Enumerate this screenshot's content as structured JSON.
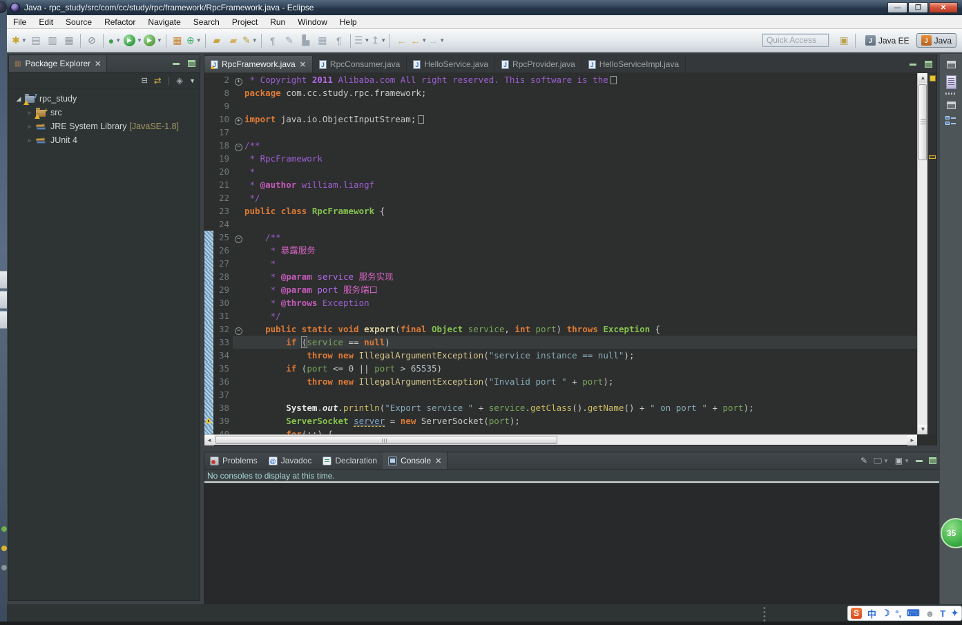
{
  "window": {
    "title": "Java - rpc_study/src/com/cc/study/rpc/framework/RpcFramework.java - Eclipse"
  },
  "titlebar_buttons": {
    "minimize": "—",
    "restore": "❐",
    "close": "✕"
  },
  "menubar": [
    "File",
    "Edit",
    "Source",
    "Refactor",
    "Navigate",
    "Search",
    "Project",
    "Run",
    "Window",
    "Help"
  ],
  "toolbar": {
    "quick_access_placeholder": "Quick Access",
    "perspectives": [
      {
        "label": "Java EE",
        "active": false
      },
      {
        "label": "Java",
        "active": true
      }
    ],
    "buttons": [
      {
        "name": "new-wizard",
        "glyph": "✱",
        "color": "#c9a227",
        "dd": true
      },
      {
        "name": "save",
        "glyph": "▤",
        "color": "#8f98a2"
      },
      {
        "name": "save-all",
        "glyph": "▥",
        "color": "#8f98a2"
      },
      {
        "name": "print",
        "glyph": "▦",
        "color": "#8f98a2"
      },
      {
        "name": "sep1",
        "sep": true
      },
      {
        "name": "skip-all-breakpoints",
        "glyph": "⊘",
        "color": "#7b8894"
      },
      {
        "name": "sep2",
        "sep": true
      },
      {
        "name": "debug",
        "glyph": "●",
        "color": "#3f9d4c",
        "dd": true
      },
      {
        "name": "run",
        "glyph": "▶",
        "circle": "#2f9e44",
        "dd": true
      },
      {
        "name": "run-last-launched",
        "glyph": "▶",
        "circle": "#5a9e44",
        "dot": "#c2302a",
        "dd": true
      },
      {
        "name": "sep3",
        "sep": true
      },
      {
        "name": "coverage",
        "glyph": "▦",
        "color": "#c77f2e",
        "dd": false
      },
      {
        "name": "new-java-class",
        "glyph": "⊕",
        "color": "#3fae6a",
        "dd": true
      },
      {
        "name": "sep4",
        "sep": true
      },
      {
        "name": "open-type",
        "glyph": "▰",
        "color": "#c9a23f"
      },
      {
        "name": "open-resource",
        "glyph": "▰",
        "color": "#d4b25f"
      },
      {
        "name": "search",
        "glyph": "✎",
        "color": "#b8a14a",
        "dd": true
      },
      {
        "name": "sep5",
        "sep": true
      },
      {
        "name": "show-whitespace",
        "glyph": "¶",
        "color": "#9aa6b0"
      },
      {
        "name": "mark-occurrences",
        "glyph": "✎",
        "color": "#9aa6b0"
      },
      {
        "name": "format",
        "glyph": "▙",
        "color": "#9aa6b0"
      },
      {
        "name": "show-source",
        "glyph": "▦",
        "color": "#9aa6b0"
      },
      {
        "name": "paragraph",
        "glyph": "¶",
        "color": "#9aa6b0"
      },
      {
        "name": "sep6",
        "sep": true
      },
      {
        "name": "last-edit-location",
        "glyph": "☰",
        "color": "#9aa6b0",
        "dd": true
      },
      {
        "name": "next-annotation",
        "glyph": "↥",
        "color": "#9aa6b0",
        "dd": true
      },
      {
        "name": "sep7",
        "sep": true
      },
      {
        "name": "back-history",
        "glyph": "←",
        "color": "#cdb36a"
      },
      {
        "name": "back",
        "glyph": "←",
        "color": "#e0a83c",
        "dd": true
      },
      {
        "name": "forward",
        "glyph": "→",
        "color": "#b9c0c6",
        "dd": true
      }
    ]
  },
  "package_explorer": {
    "title": "Package Explorer",
    "tree": [
      {
        "label": "rpc_study",
        "icon": "project",
        "expander": "open",
        "warn": true,
        "indent": 0
      },
      {
        "label": "src",
        "icon": "package",
        "expander": "closed",
        "warn": true,
        "indent": 1
      },
      {
        "label": "JRE System Library",
        "suffix": "[JavaSE-1.8]",
        "icon": "library",
        "expander": "closed",
        "warn": false,
        "indent": 1
      },
      {
        "label": "JUnit 4",
        "icon": "library",
        "expander": "closed",
        "warn": false,
        "indent": 1
      }
    ]
  },
  "editor": {
    "tabs": [
      {
        "label": "RpcFramework.java",
        "active": true,
        "warn": true,
        "closable": true
      },
      {
        "label": "RpcConsumer.java",
        "active": false
      },
      {
        "label": "HelloService.java",
        "active": false
      },
      {
        "label": "RpcProvider.java",
        "active": false
      },
      {
        "label": "HelloServiceImpl.java",
        "active": false
      }
    ],
    "lines": [
      {
        "n": "2",
        "fold": "+",
        "endbox": true,
        "seg": [
          [
            "c",
            " * Copyright "
          ],
          [
            "cb",
            "2011"
          ],
          [
            "c",
            " Alibaba.com All right reserved. This software is the"
          ]
        ]
      },
      {
        "n": "8",
        "seg": [
          [
            "k",
            "package"
          ],
          [
            "d",
            " com.cc.study.rpc.framework;"
          ]
        ]
      },
      {
        "n": "9",
        "seg": []
      },
      {
        "n": "10",
        "fold": "+",
        "endbox": true,
        "seg": [
          [
            "k",
            "import"
          ],
          [
            "d",
            " java.io.ObjectInputStream;"
          ]
        ]
      },
      {
        "n": "17",
        "seg": []
      },
      {
        "n": "18",
        "fold": "-",
        "seg": [
          [
            "c",
            "/**"
          ]
        ]
      },
      {
        "n": "19",
        "seg": [
          [
            "c",
            " * RpcFramework"
          ]
        ]
      },
      {
        "n": "20",
        "seg": [
          [
            "c",
            " * "
          ]
        ]
      },
      {
        "n": "21",
        "seg": [
          [
            "c",
            " * "
          ],
          [
            "ct",
            "@author"
          ],
          [
            "c",
            " william.liangf"
          ]
        ]
      },
      {
        "n": "22",
        "seg": [
          [
            "c",
            " */"
          ]
        ]
      },
      {
        "n": "23",
        "seg": [
          [
            "k",
            "public"
          ],
          [
            "d",
            " "
          ],
          [
            "k",
            "class"
          ],
          [
            "d",
            " "
          ],
          [
            "t",
            "RpcFramework"
          ],
          [
            "d",
            " {"
          ]
        ]
      },
      {
        "n": "24",
        "seg": []
      },
      {
        "n": "25",
        "fold": "-",
        "range": true,
        "seg": [
          [
            "d",
            "    "
          ],
          [
            "c",
            "/**"
          ]
        ]
      },
      {
        "n": "26",
        "range": true,
        "seg": [
          [
            "c",
            "     * "
          ],
          [
            "cn",
            "暴露服务"
          ]
        ]
      },
      {
        "n": "27",
        "range": true,
        "seg": [
          [
            "c",
            "     * "
          ]
        ]
      },
      {
        "n": "28",
        "range": true,
        "seg": [
          [
            "c",
            "     * "
          ],
          [
            "ct",
            "@param"
          ],
          [
            "c",
            " "
          ],
          [
            "ci",
            "service"
          ],
          [
            "c",
            " "
          ],
          [
            "cn",
            "服务实现"
          ]
        ]
      },
      {
        "n": "29",
        "range": true,
        "seg": [
          [
            "c",
            "     * "
          ],
          [
            "ct",
            "@param"
          ],
          [
            "c",
            " "
          ],
          [
            "ci",
            "port"
          ],
          [
            "c",
            " "
          ],
          [
            "cn",
            "服务端口"
          ]
        ]
      },
      {
        "n": "30",
        "range": true,
        "seg": [
          [
            "c",
            "     * "
          ],
          [
            "ct",
            "@throws"
          ],
          [
            "c",
            " Exception"
          ]
        ]
      },
      {
        "n": "31",
        "range": true,
        "seg": [
          [
            "c",
            "     */"
          ]
        ]
      },
      {
        "n": "32",
        "fold": "-",
        "range": true,
        "seg": [
          [
            "d",
            "    "
          ],
          [
            "k",
            "public"
          ],
          [
            "d",
            " "
          ],
          [
            "k",
            "static"
          ],
          [
            "d",
            " "
          ],
          [
            "k",
            "void"
          ],
          [
            "d",
            " "
          ],
          [
            "md",
            "export"
          ],
          [
            "d",
            "("
          ],
          [
            "k",
            "final"
          ],
          [
            "d",
            " "
          ],
          [
            "t",
            "Object"
          ],
          [
            "d",
            " "
          ],
          [
            "v",
            "service"
          ],
          [
            "d",
            ", "
          ],
          [
            "k",
            "int"
          ],
          [
            "d",
            " "
          ],
          [
            "v",
            "port"
          ],
          [
            "d",
            ") "
          ],
          [
            "k",
            "throws"
          ],
          [
            "d",
            " "
          ],
          [
            "t",
            "Exception"
          ],
          [
            "d",
            " {"
          ]
        ]
      },
      {
        "n": "33",
        "range": true,
        "cur": true,
        "seg": [
          [
            "d",
            "        "
          ],
          [
            "k",
            "if"
          ],
          [
            "d",
            " "
          ],
          [
            "bb",
            "("
          ],
          [
            "v",
            "service"
          ],
          [
            "d",
            " == "
          ],
          [
            "k",
            "null"
          ],
          [
            "d",
            ")"
          ]
        ]
      },
      {
        "n": "34",
        "range": true,
        "seg": [
          [
            "d",
            "            "
          ],
          [
            "k",
            "throw"
          ],
          [
            "d",
            " "
          ],
          [
            "k",
            "new"
          ],
          [
            "d",
            " "
          ],
          [
            "ex",
            "IllegalArgumentException"
          ],
          [
            "d",
            "("
          ],
          [
            "s",
            "\"service instance == null\""
          ],
          [
            "d",
            ");"
          ]
        ]
      },
      {
        "n": "35",
        "range": true,
        "seg": [
          [
            "d",
            "        "
          ],
          [
            "k",
            "if"
          ],
          [
            "d",
            " ("
          ],
          [
            "v",
            "port"
          ],
          [
            "d",
            " <= "
          ],
          [
            "n2",
            "0"
          ],
          [
            "d",
            " || "
          ],
          [
            "v",
            "port"
          ],
          [
            "d",
            " > "
          ],
          [
            "n2",
            "65535"
          ],
          [
            "d",
            ")"
          ]
        ]
      },
      {
        "n": "36",
        "range": true,
        "seg": [
          [
            "d",
            "            "
          ],
          [
            "k",
            "throw"
          ],
          [
            "d",
            " "
          ],
          [
            "k",
            "new"
          ],
          [
            "d",
            " "
          ],
          [
            "ex",
            "IllegalArgumentException"
          ],
          [
            "d",
            "("
          ],
          [
            "s",
            "\"Invalid port \""
          ],
          [
            "d",
            " + "
          ],
          [
            "v",
            "port"
          ],
          [
            "d",
            ");"
          ]
        ]
      },
      {
        "n": "37",
        "range": true,
        "seg": []
      },
      {
        "n": "38",
        "range": true,
        "seg": [
          [
            "d",
            "        "
          ],
          [
            "sb",
            "System"
          ],
          [
            "d",
            "."
          ],
          [
            "si",
            "out"
          ],
          [
            "d",
            "."
          ],
          [
            "m",
            "println"
          ],
          [
            "d",
            "("
          ],
          [
            "s",
            "\"Export service \""
          ],
          [
            "d",
            " + "
          ],
          [
            "v",
            "service"
          ],
          [
            "d",
            "."
          ],
          [
            "m",
            "getClass"
          ],
          [
            "d",
            "()."
          ],
          [
            "m",
            "getName"
          ],
          [
            "d",
            "() + "
          ],
          [
            "s",
            "\" on port \""
          ],
          [
            "d",
            " + "
          ],
          [
            "v",
            "port"
          ],
          [
            "d",
            ");"
          ]
        ]
      },
      {
        "n": "39",
        "range": true,
        "warn": true,
        "seg": [
          [
            "d",
            "        "
          ],
          [
            "t",
            "ServerSocket"
          ],
          [
            "d",
            " "
          ],
          [
            "lo",
            "server"
          ],
          [
            "d",
            " = "
          ],
          [
            "k",
            "new"
          ],
          [
            "d",
            " "
          ],
          [
            "d",
            "ServerSocket"
          ],
          [
            "d",
            "("
          ],
          [
            "v",
            "port"
          ],
          [
            "d",
            ");"
          ]
        ]
      },
      {
        "n": "40",
        "range": true,
        "seg": [
          [
            "d",
            "        "
          ],
          [
            "k",
            "for"
          ],
          [
            "d",
            "(;;) {"
          ]
        ]
      }
    ]
  },
  "console": {
    "tabs": [
      {
        "label": "Problems",
        "icon": "problems",
        "active": false
      },
      {
        "label": "Javadoc",
        "icon": "javadoc",
        "active": false
      },
      {
        "label": "Declaration",
        "icon": "declaration",
        "active": false
      },
      {
        "label": "Console",
        "icon": "console",
        "active": true,
        "closable": true
      }
    ],
    "message": "No consoles to display at this time.",
    "tools": [
      {
        "name": "pin-console",
        "glyph": "✎"
      },
      {
        "name": "display-selected-console",
        "glyph": "🖵",
        "dd": true
      },
      {
        "name": "open-console",
        "glyph": "▣",
        "dd": true
      }
    ]
  },
  "ime": {
    "icons": [
      {
        "name": "sogou-logo",
        "glyph": "S"
      },
      {
        "name": "chinese-mode",
        "glyph": "中",
        "color": "#2b6bd3"
      },
      {
        "name": "half-moon",
        "glyph": "☽",
        "color": "#2b6bd3"
      },
      {
        "name": "punctuation",
        "glyph": "°,",
        "color": "#2b6bd3"
      },
      {
        "name": "soft-keyboard",
        "glyph": "⌨",
        "color": "#2b6bd3"
      },
      {
        "name": "user",
        "glyph": "☻",
        "color": "#9aa0a6"
      },
      {
        "name": "skin",
        "glyph": "T",
        "color": "#2b6bd3"
      },
      {
        "name": "toolbox",
        "glyph": "✦",
        "color": "#2b6bd3"
      }
    ]
  },
  "overlay_badge": "35"
}
